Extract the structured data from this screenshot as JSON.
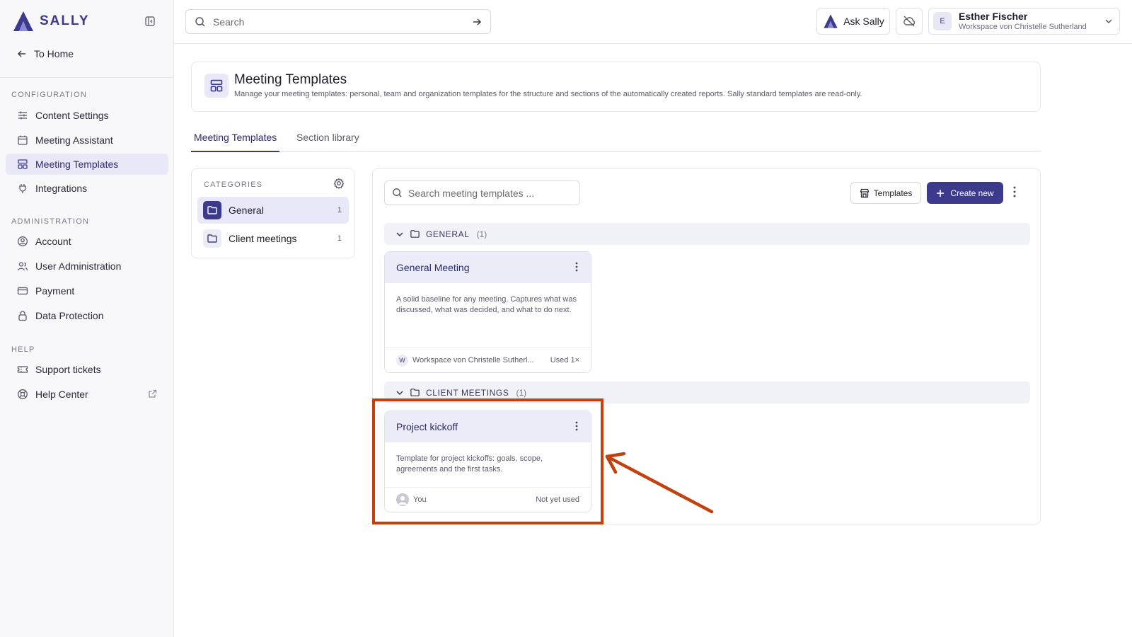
{
  "app": {
    "brand": "SALLY",
    "colors": {
      "accent": "#3b3a8c",
      "accent_light": "#e8e8f8",
      "annotation": "#c2410c"
    }
  },
  "sidebar": {
    "to_home": "To Home",
    "sections": [
      {
        "label": "CONFIGURATION",
        "items": [
          {
            "label": "Content Settings",
            "icon": "sliders-icon"
          },
          {
            "label": "Meeting Assistant",
            "icon": "calendar-icon"
          },
          {
            "label": "Meeting Templates",
            "icon": "layout-icon",
            "active": true
          },
          {
            "label": "Integrations",
            "icon": "plug-icon"
          }
        ]
      },
      {
        "label": "ADMINISTRATION",
        "items": [
          {
            "label": "Account",
            "icon": "user-circle-icon"
          },
          {
            "label": "User Administration",
            "icon": "users-icon"
          },
          {
            "label": "Payment",
            "icon": "credit-card-icon"
          },
          {
            "label": "Data Protection",
            "icon": "lock-icon"
          }
        ]
      },
      {
        "label": "HELP",
        "items": [
          {
            "label": "Support tickets",
            "icon": "ticket-icon"
          },
          {
            "label": "Help Center",
            "icon": "lifebuoy-icon"
          }
        ]
      }
    ]
  },
  "topbar": {
    "search_placeholder": "Search",
    "ask_label": "Ask Sally",
    "user": {
      "initial": "E",
      "name": "Esther Fischer",
      "workspace": "Workspace von Christelle Sutherland"
    }
  },
  "page": {
    "title": "Meeting Templates",
    "description": "Manage your meeting templates: personal, team and organization templates for the structure and sections of the automatically created reports. Sally standard templates are read-only.",
    "tabs": [
      {
        "label": "Meeting Templates",
        "active": true
      },
      {
        "label": "Section library",
        "active": false
      }
    ]
  },
  "categories": {
    "label": "CATEGORIES",
    "items": [
      {
        "name": "General",
        "count": "1",
        "active": true
      },
      {
        "name": "Client meetings",
        "count": "1",
        "active": false
      }
    ]
  },
  "templates_panel": {
    "search_placeholder": "Search meeting templates ...",
    "templates_button": "Templates",
    "create_button": "Create new",
    "groups": [
      {
        "name": "GENERAL",
        "count": "(1)",
        "cards": [
          {
            "title": "General Meeting",
            "description": "A solid baseline for any meeting. Captures what was discussed, what was decided, and what to do next.",
            "owner": "Workspace von Christelle Sutherl...",
            "owner_badge": "W",
            "usage": "Used 1×"
          }
        ]
      },
      {
        "name": "CLIENT MEETINGS",
        "count": "(1)",
        "cards": [
          {
            "title": "Project kickoff",
            "description": "Template for project kickoffs: goals, scope, agreements and the first tasks.",
            "owner": "You",
            "usage": "Not yet used"
          }
        ]
      }
    ]
  }
}
